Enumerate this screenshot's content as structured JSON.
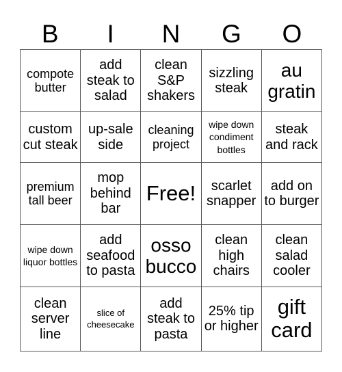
{
  "header": {
    "letters": [
      "B",
      "I",
      "N",
      "G",
      "O"
    ]
  },
  "rows": [
    [
      "compote butter",
      "add steak to salad",
      "clean S&P shakers",
      "sizzling steak",
      "au gratin"
    ],
    [
      "custom cut steak",
      "up-sale side",
      "cleaning project",
      "wipe down condiment bottles",
      "steak and rack"
    ],
    [
      "premium tall beer",
      "mop behind bar",
      "Free!",
      "scarlet snapper",
      "add on to burger"
    ],
    [
      "wipe down liquor bottles",
      "add seafood to pasta",
      "osso bucco",
      "clean high chairs",
      "clean salad cooler"
    ],
    [
      "clean server line",
      "slice of cheesecake",
      "add steak to pasta",
      "25% tip or higher",
      "gift card"
    ]
  ]
}
